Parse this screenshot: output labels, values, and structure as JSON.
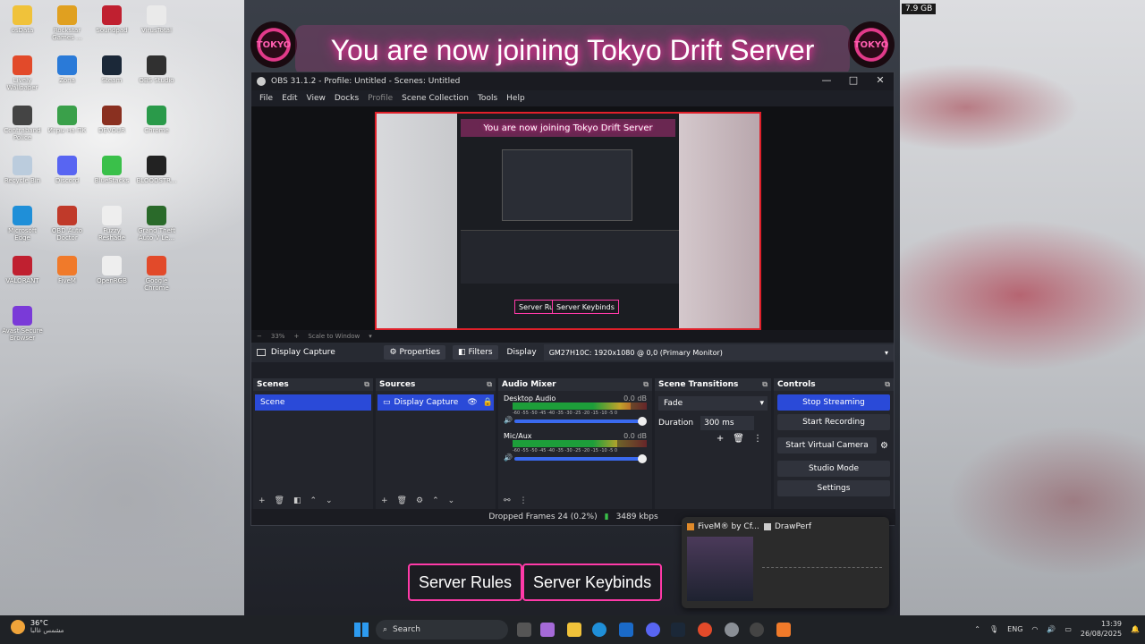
{
  "game": {
    "banner": "You are now joining Tokyo Drift Server",
    "icon_text": "TOKYO",
    "buttons": [
      "Server Rules",
      "Server Keybinds"
    ]
  },
  "desktop_icons": [
    {
      "label": "osData",
      "color": "#f0c23a"
    },
    {
      "label": "Rockstar Games ...",
      "color": "#e0a020"
    },
    {
      "label": "Soundpad",
      "color": "#c02030"
    },
    {
      "label": "VirusTotal",
      "color": "#eaeaea"
    },
    {
      "label": "Lively Wallpaper",
      "color": "#e24a2a"
    },
    {
      "label": "Zona",
      "color": "#2a7ad8"
    },
    {
      "label": "Steam",
      "color": "#1b2838"
    },
    {
      "label": "OBS Studio",
      "color": "#303030"
    },
    {
      "label": "Contraband Police",
      "color": "#444"
    },
    {
      "label": "Игры на ПК",
      "color": "#3aa04a"
    },
    {
      "label": "DEVOUR",
      "color": "#8a3020"
    },
    {
      "label": "Chrome",
      "color": "#2a9a4a"
    },
    {
      "label": "Recycle Bin",
      "color": "#bcd"
    },
    {
      "label": "Discord",
      "color": "#5865f2"
    },
    {
      "label": "BlueStacks",
      "color": "#3ac04a"
    },
    {
      "label": "BLOODSTR...",
      "color": "#222"
    },
    {
      "label": "Microsoft Edge",
      "color": "#1f8fd8"
    },
    {
      "label": "OBD Auto Doctor",
      "color": "#c03a2a"
    },
    {
      "label": "Fuzzy Reshade 2025",
      "color": "#eee"
    },
    {
      "label": "Grand Theft Auto V Le...",
      "color": "#2a6a2a"
    },
    {
      "label": "VALORANT",
      "color": "#c02030"
    },
    {
      "label": "FiveM",
      "color": "#f07a2a"
    },
    {
      "label": "OpenRGB",
      "color": "#eee"
    },
    {
      "label": "Google Chrome",
      "color": "#e24a2a"
    },
    {
      "label": "Avast Secure Browser",
      "color": "#7a3ad8"
    }
  ],
  "obs": {
    "title": "OBS 31.1.2 - Profile: Untitled - Scenes: Untitled",
    "window_controls": [
      "—",
      "□",
      "✕"
    ],
    "menu": [
      {
        "label": "File",
        "dim": false
      },
      {
        "label": "Edit",
        "dim": false
      },
      {
        "label": "View",
        "dim": false
      },
      {
        "label": "Docks",
        "dim": false
      },
      {
        "label": "Profile",
        "dim": true
      },
      {
        "label": "Scene Collection",
        "dim": false
      },
      {
        "label": "Tools",
        "dim": false
      },
      {
        "label": "Help",
        "dim": false
      }
    ],
    "preview_banner": "You are now joining Tokyo Drift Server",
    "preview_buttons": [
      "Server Rules",
      "Server Keybinds"
    ],
    "zoom": {
      "minus": "−",
      "value": "33%",
      "plus": "+",
      "scale": "Scale to Window",
      "arrow": "▾"
    },
    "source_bar": {
      "source": "Display Capture",
      "properties": "Properties",
      "filters": "Filters",
      "display_label": "Display",
      "display_value": "GM27H10C: 1920x1080 @ 0,0 (Primary Monitor)"
    },
    "scenes": {
      "header": "Scenes",
      "items": [
        "Scene"
      ]
    },
    "sources": {
      "header": "Sources",
      "items": [
        "Display Capture"
      ]
    },
    "audio_mixer": {
      "header": "Audio Mixer",
      "channels": [
        {
          "name": "Desktop Audio",
          "db": "0.0 dB",
          "level": 0.88
        },
        {
          "name": "Mic/Aux",
          "db": "0.0 dB",
          "level": 0.78
        }
      ],
      "scale": "-60 -55 -50 -45 -40 -35 -30 -25 -20 -15 -10 -5 0"
    },
    "transitions": {
      "header": "Scene Transitions",
      "type": "Fade",
      "duration_label": "Duration",
      "duration": "300 ms"
    },
    "controls": {
      "header": "Controls",
      "buttons": [
        "Stop Streaming",
        "Start Recording",
        "Start Virtual Camera",
        "Studio Mode",
        "Settings"
      ]
    },
    "status": {
      "dropped": "Dropped Frames 24 (0.2%)",
      "bitrate": "3489 kbps"
    }
  },
  "thumbnail": {
    "app1": "FiveM® by Cf...",
    "app2": "DrawPerf"
  },
  "top_right_text": "7.9 GB",
  "taskbar": {
    "temp": "36°C",
    "weather": "مشمس غالبا",
    "search": "Search",
    "lang": "ENG",
    "time": "13:39",
    "date": "26/08/2025"
  },
  "colors": {
    "obs_accent": "#2a4ad8",
    "preview_border": "#e0202a",
    "neon": "#ff3aa8"
  }
}
